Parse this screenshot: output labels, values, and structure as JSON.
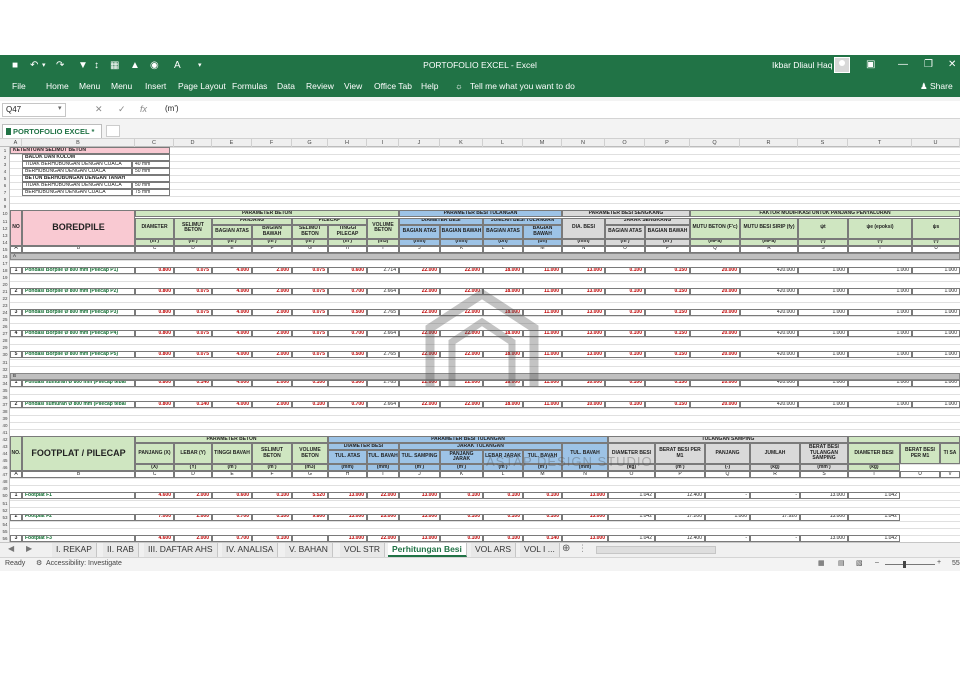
{
  "window": {
    "title": "PORTOFOLIO EXCEL  -  Excel",
    "user": "Ikbar Dliaul Haq",
    "share": "Share",
    "tellme": "Tell me what you want to do"
  },
  "menu": [
    "File",
    "Home",
    "Menu",
    "Menu",
    "Insert",
    "Page Layout",
    "Formulas",
    "Data",
    "Review",
    "View",
    "Office Tab",
    "Help"
  ],
  "formula_bar": {
    "name_box": "Q47",
    "value": "(m')"
  },
  "workbook_tab": "PORTOFOLIO EXCEL *",
  "columns": [
    "A",
    "B",
    "C",
    "D",
    "E",
    "F",
    "G",
    "H",
    "I",
    "J",
    "K",
    "L",
    "M",
    "N",
    "O",
    "P",
    "Q",
    "R",
    "S",
    "T",
    "U"
  ],
  "rows": [
    "1",
    "2",
    "3",
    "4",
    "5",
    "6",
    "7",
    "8",
    "9",
    "10",
    "11",
    "12",
    "13",
    "14",
    "15",
    "16",
    "17",
    "18",
    "19",
    "20",
    "21",
    "22",
    "23",
    "24",
    "25",
    "26",
    "27",
    "28",
    "29",
    "30",
    "31",
    "32",
    "33",
    "34",
    "35",
    "36",
    "37",
    "38",
    "39",
    "40",
    "41",
    "42",
    "43",
    "44",
    "45",
    "46",
    "47",
    "48",
    "49",
    "50",
    "51",
    "52",
    "53",
    "54",
    "55",
    "56"
  ],
  "selimut": {
    "title": "KETENTUAN SELIMUT BETON",
    "sub1": "BALOK DAN KOLOM",
    "r1": "TIDAK BERHUBUNGAN DENGAN CUACA",
    "v1": "40 mm",
    "r2": "BERHUBUNGAN DENGAN CUACA",
    "v2": "50 mm",
    "sub2": "BETON BERHUBUNGAN DENGAN TANAH",
    "r3": "TIDAK BERHUBUNGAN DENGAN CUACA",
    "v3": "50 mm",
    "r4": "BERHUBUNGAN DENGAN CUACA",
    "v4": "75 mm"
  },
  "bore": {
    "no": "NO",
    "title": "BOREDPILE",
    "param_beton": "PARAMETER BETON",
    "param_besi": "PARAMETER BESI TULANGAN",
    "param_sengkang": "PARAMETER BESI SENGKANG",
    "faktor": "FAKTOR MODIFIKASI UNTUK PANJANG PENYALURAN",
    "diameter": "DIAMETER",
    "selimut": "SELIMUT BETON",
    "panjang": "PANJANG",
    "bagian_atas": "BAGIAN ATAS",
    "bagian_bawah": "BAGIAN BAWAH",
    "pilecap": "PILECAP",
    "selimut_beton": "SELIMUT BETON",
    "tinggi_pilecap": "TINGGI PILECAP",
    "volume_beton": "VOLUME BETON",
    "diameter_besi": "DIAMETER BESI",
    "jumlah_besi": "JUMLAH BESI TULANGAN",
    "dia_besi": "DIA. BESI",
    "jarak_sengkang": "JARAK SENGKANG",
    "mutu_beton": "MUTU BETON (F'c)",
    "mutu_besi": "MUTU BESI SIRIP (fy)",
    "psi_t": "ψt",
    "psi_e": "ψe (epoksi)",
    "psi_s": "ψs",
    "units": [
      "(m')",
      "(m')",
      "(m')",
      "(m')",
      "(m')",
      "(m')",
      "(m3)",
      "(mm)",
      "(mm)",
      "(bh)",
      "(bh)",
      "(mm)",
      "(m')",
      "(m')",
      "(MPa)",
      "(MPa)",
      "(-)",
      "(-)",
      "(-)"
    ],
    "letters": [
      "A",
      "B",
      "C",
      "D",
      "E",
      "F",
      "G",
      "H",
      "I",
      "J",
      "K",
      "L",
      "M",
      "N",
      "O",
      "P",
      "Q",
      "R",
      "S",
      "T",
      "U"
    ],
    "sec_a": "A",
    "sec_b": "B",
    "items": [
      {
        "no": "1",
        "label": "Pondasi Borpile Ø 800 mm (Pilecap P1)",
        "vals": [
          "0.800",
          "0.075",
          "4.000",
          "2.000",
          "0.075",
          "0.600",
          "2.714",
          "22.000",
          "22.000",
          "18.000",
          "11.000",
          "13.000",
          "0.100",
          "0.150",
          "20.000",
          "420.000",
          "1.000",
          "1.000",
          "1.000"
        ]
      },
      {
        "no": "2",
        "label": "Pondasi Borpile Ø 800 mm (Pilecap P2)",
        "vals": [
          "0.800",
          "0.075",
          "4.000",
          "2.000",
          "0.075",
          "0.700",
          "2.664",
          "22.000",
          "22.000",
          "18.000",
          "11.000",
          "13.000",
          "0.100",
          "0.150",
          "20.000",
          "420.000",
          "1.000",
          "1.000",
          "1.000"
        ]
      },
      {
        "no": "3",
        "label": "Pondasi Borpile Ø 800 mm (Pilecap P3)",
        "vals": [
          "0.800",
          "0.075",
          "4.000",
          "2.000",
          "0.075",
          "0.500",
          "2.765",
          "22.000",
          "22.000",
          "18.000",
          "11.000",
          "13.000",
          "0.100",
          "0.150",
          "20.000",
          "420.000",
          "1.000",
          "1.000",
          "1.000"
        ]
      },
      {
        "no": "4",
        "label": "Pondasi Borpile Ø 800 mm (Pilecap P4)",
        "vals": [
          "0.800",
          "0.075",
          "4.000",
          "2.000",
          "0.075",
          "0.700",
          "2.664",
          "22.000",
          "22.000",
          "18.000",
          "11.000",
          "13.000",
          "0.100",
          "0.150",
          "20.000",
          "420.000",
          "1.000",
          "1.000",
          "1.000"
        ]
      },
      {
        "no": "5",
        "label": "Pondasi Borpile Ø 800 mm (Pilecap P5)",
        "vals": [
          "0.800",
          "0.075",
          "4.000",
          "2.000",
          "0.075",
          "0.500",
          "2.765",
          "22.000",
          "22.000",
          "18.000",
          "11.000",
          "13.000",
          "0.100",
          "0.150",
          "20.000",
          "420.000",
          "1.000",
          "1.000",
          "1.000"
        ]
      }
    ],
    "items_b": [
      {
        "no": "1",
        "label": "Pondasi sumuran Ø 800 mm (Pilecap tebal",
        "vals": [
          "0.800",
          "0.140",
          "4.000",
          "2.000",
          "0.100",
          "0.500",
          "2.765",
          "22.000",
          "22.000",
          "18.000",
          "11.000",
          "10.000",
          "0.100",
          "0.150",
          "20.000",
          "420.000",
          "1.000",
          "1.000",
          "1.000"
        ]
      },
      {
        "no": "2",
        "label": "Pondasi sumuran Ø 800 mm (Pilecap tebal",
        "vals": [
          "0.800",
          "0.140",
          "4.000",
          "2.000",
          "0.100",
          "0.700",
          "2.664",
          "22.000",
          "22.000",
          "18.000",
          "11.000",
          "10.000",
          "0.100",
          "0.150",
          "20.000",
          "420.000",
          "1.000",
          "1.000",
          "1.000"
        ]
      }
    ]
  },
  "foot": {
    "no": "NO.",
    "title": "FOOTPLAT / PILECAP",
    "param_beton": "PARAMETER BETON",
    "param_besi": "PARAMETER BESI TULANGAN",
    "tul_samping": "TULANGAN SAMPING",
    "panjang": "PANJANG (X)",
    "lebar": "LEBAR (Y)",
    "tinggi": "TINGGI BAVAH",
    "selimut": "SELIMUT BETON",
    "volume": "VOLUME BETON",
    "diameter_besi": "DIAMETER BESI",
    "tul_atas": "TUL. ATAS",
    "tul_bavah": "TUL. BAVAH",
    "jarak": "JARAK TULANGAN",
    "tul_samping_h": "TUL. SAMPING",
    "panjang_j": "PANJANG JARAK",
    "lebar_j": "LEBAR JARAK",
    "tul_b": "TUL. BAVAH",
    "diameter_h": "DIAMETER BESI",
    "berat_h": "BERAT BESI PER M1",
    "panjang_h": "PANJANG",
    "jumlah_h": "JUMLAH",
    "berat_sam": "BERAT BESI TULANGAN SAMPING",
    "diameter_h2": "DIAMETER BESI",
    "berat_h2": "BERAT BESI PER M1",
    "ti_sa": "TI SA",
    "units": [
      "(X)",
      "(Y)",
      "(m')",
      "(m')",
      "(m3)",
      "(mm)",
      "(mm)",
      "(m')",
      "(m')",
      "(m')",
      "(m')",
      "(mm)",
      "(kg)",
      "(m')",
      "(-)",
      "(kg)",
      "(mm')",
      "(kg)"
    ],
    "letters": [
      "A",
      "B",
      "C",
      "D",
      "E",
      "F",
      "G",
      "H",
      "I",
      "J",
      "K",
      "L",
      "M",
      "N",
      "O",
      "P",
      "Q",
      "R",
      "S",
      "T",
      "U",
      "V",
      "W",
      "X",
      "Y",
      "Z"
    ],
    "items": [
      {
        "no": "1",
        "label": "Footplat F1",
        "vals": [
          "4.600",
          "2.000",
          "0.600",
          "0.100",
          "5.520",
          "13.000",
          "22.000",
          "13.000",
          "0.100",
          "0.100",
          "0.100",
          "13.000",
          "1.042",
          "12.400",
          "-",
          "-",
          "13.000",
          "1.042"
        ]
      },
      {
        "no": "2",
        "label": "Footplat F2",
        "vals": [
          "7.000",
          "2.000",
          "0.700",
          "0.100",
          "9.800",
          "13.000",
          "25.000",
          "13.000",
          "0.100",
          "0.100",
          "0.100",
          "13.000",
          "1.042",
          "17.200",
          "1.000",
          "17.920",
          "13.000",
          "1.042"
        ]
      },
      {
        "no": "3",
        "label": "Footplat F3",
        "vals": [
          "4.600",
          "2.000",
          "0.700",
          "0.100",
          "",
          "13.000",
          "22.000",
          "13.000",
          "0.100",
          "0.100",
          "0.140",
          "13.000",
          "1.042",
          "12.400",
          "-",
          "-",
          "13.000",
          "1.042"
        ]
      }
    ]
  },
  "watermark": "ASTAP DESIGN STUDIO",
  "sheet_tabs": [
    "I. REKAP",
    "II. RAB",
    "III. DAFTAR AHS",
    "IV. ANALISA",
    "V. BAHAN",
    "VOL STR",
    "Perhitungan Besi",
    "VOL ARS",
    "VOL I ..."
  ],
  "status": {
    "ready": "Ready",
    "accessibility": "Accessibility: Investigate",
    "zoom": "55"
  },
  "colors": {
    "excel_green": "#217346",
    "header_pink": "#f9c9d2",
    "header_green": "#cfe6c1",
    "header_blue": "#9dc3e6",
    "header_gray": "#d9d9d9",
    "red": "#c00000"
  }
}
